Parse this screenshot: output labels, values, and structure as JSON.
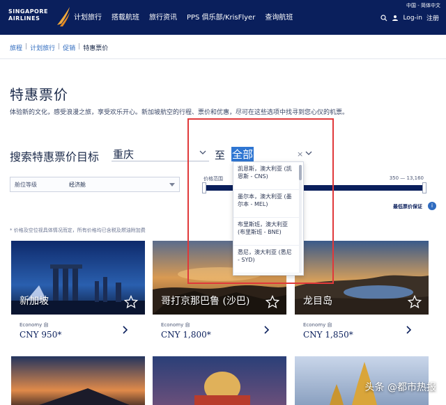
{
  "header": {
    "logo_line1": "SINGAPORE",
    "logo_line2": "AIRLINES",
    "nav": [
      "计划旅行",
      "搭载航班",
      "旅行资讯",
      "PPS 俱乐部/KrisFlyer",
      "查询航班"
    ],
    "utility": "中国 - 简体中文",
    "login": "Log-in",
    "signup": "注册"
  },
  "breadcrumb": {
    "items": [
      "旅程",
      "计划旅行",
      "促销"
    ],
    "current": "特惠票价"
  },
  "page": {
    "title": "特惠票价",
    "intro": "体验新的文化，感受浪漫之旅，享受欢乐开心。新加坡航空的行程、票价和优惠，尽可在这些选项中找寻到您心仪的机票。"
  },
  "search": {
    "label": "搜索特惠票价目标",
    "from_value": "重庆",
    "to_label": "至",
    "to_value": "全部",
    "clear_icon": "×"
  },
  "cabin": {
    "label": "舱位等级",
    "value": "经济舱"
  },
  "price": {
    "label": "价格范围",
    "range": "350 — 13,160",
    "best_label": "最低票价保证"
  },
  "note": "* 价格及空位视具体情况而定，所有价格均已含税及燃油附加费",
  "dropdown": {
    "items": [
      "凯恩斯，澳大利亚 (凯恩斯 - CNS)",
      "墨尔本，澳大利亚 (墨尔本 - MEL)",
      "布里斯班，澳大利亚 (布里斯班 - BNE)",
      "悉尼，澳大利亚 (悉尼 - SYD)"
    ]
  },
  "cards": [
    {
      "city": "新加坡",
      "class": "Economy 自",
      "price": "CNY 950*"
    },
    {
      "city": "哥打京那巴鲁 (沙巴)",
      "class": "Economy 自",
      "price": "CNY 1,800*"
    },
    {
      "city": "龙目岛",
      "class": "Economy 自",
      "price": "CNY 1,850*"
    }
  ],
  "watermark": "头条 @都市热报",
  "colors": {
    "brand_navy": "#0a1f5c",
    "link_blue": "#2f6bbf",
    "highlight_red": "#e0383a",
    "selection_blue": "#2f76d2"
  }
}
